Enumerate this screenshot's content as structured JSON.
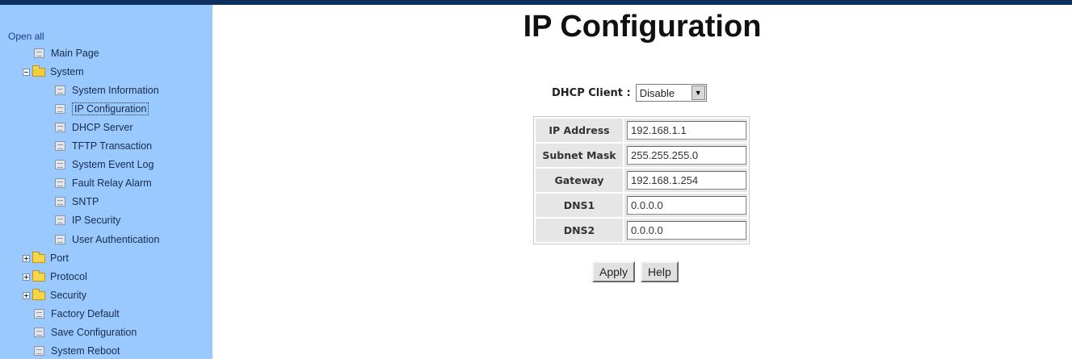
{
  "sidebar": {
    "open_all": "Open all",
    "items": [
      {
        "label": "Main Page"
      },
      {
        "label": "System"
      },
      {
        "label": "System Information"
      },
      {
        "label": "IP Configuration"
      },
      {
        "label": "DHCP Server"
      },
      {
        "label": "TFTP Transaction"
      },
      {
        "label": "System Event Log"
      },
      {
        "label": "Fault Relay Alarm"
      },
      {
        "label": "SNTP"
      },
      {
        "label": "IP Security"
      },
      {
        "label": "User Authentication"
      },
      {
        "label": "Port"
      },
      {
        "label": "Protocol"
      },
      {
        "label": "Security"
      },
      {
        "label": "Factory Default"
      },
      {
        "label": "Save Configuration"
      },
      {
        "label": "System Reboot"
      }
    ]
  },
  "main": {
    "title": "IP Configuration",
    "dhcp_label": "DHCP Client :",
    "dhcp_value": "Disable",
    "fields": [
      {
        "label": "IP Address",
        "value": "192.168.1.1"
      },
      {
        "label": "Subnet Mask",
        "value": "255.255.255.0"
      },
      {
        "label": "Gateway",
        "value": "192.168.1.254"
      },
      {
        "label": "DNS1",
        "value": "0.0.0.0"
      },
      {
        "label": "DNS2",
        "value": "0.0.0.0"
      }
    ],
    "apply_label": "Apply",
    "help_label": "Help"
  },
  "colors": {
    "sidebar_bg": "#99c9ff",
    "topbar": "#0d2f62",
    "label_cell_bg": "#e6e6e6"
  }
}
